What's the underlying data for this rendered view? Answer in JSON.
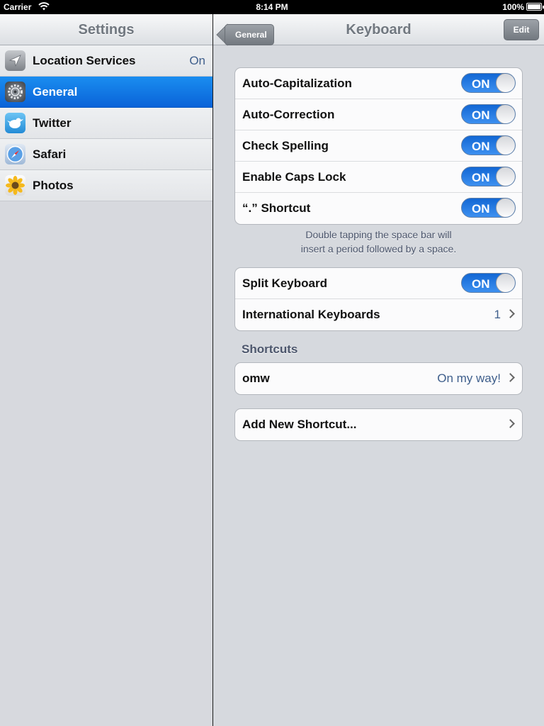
{
  "status": {
    "carrier": "Carrier",
    "time": "8:14 PM",
    "battery": "100%"
  },
  "master": {
    "title": "Settings",
    "items": [
      {
        "label": "Location Services",
        "value": "On",
        "icon": "location-icon"
      },
      {
        "label": "General",
        "value": "",
        "icon": "gear-icon",
        "selected": true
      },
      {
        "label": "Twitter",
        "value": "",
        "icon": "twitter-icon"
      },
      {
        "label": "Safari",
        "value": "",
        "icon": "safari-icon"
      },
      {
        "label": "Photos",
        "value": "",
        "icon": "photos-icon"
      }
    ]
  },
  "detail": {
    "title": "Keyboard",
    "back_label": "General",
    "edit_label": "Edit",
    "group1": [
      {
        "label": "Auto-Capitalization",
        "toggle": "ON"
      },
      {
        "label": "Auto-Correction",
        "toggle": "ON"
      },
      {
        "label": "Check Spelling",
        "toggle": "ON"
      },
      {
        "label": "Enable Caps Lock",
        "toggle": "ON"
      },
      {
        "label": "“.” Shortcut",
        "toggle": "ON"
      }
    ],
    "footnote_line1": "Double tapping the space bar will",
    "footnote_line2": "insert a period followed by a space.",
    "split_keyboard": {
      "label": "Split Keyboard",
      "toggle": "ON"
    },
    "intl_keyboards": {
      "label": "International Keyboards",
      "value": "1"
    },
    "shortcuts_header": "Shortcuts",
    "shortcut": {
      "label": "omw",
      "value": "On my way!"
    },
    "add_shortcut": {
      "label": "Add New Shortcut..."
    }
  },
  "colors": {
    "accent": "#0a63d8",
    "toggle_on": "#1f78e0",
    "value_text": "#3f5f8c"
  }
}
